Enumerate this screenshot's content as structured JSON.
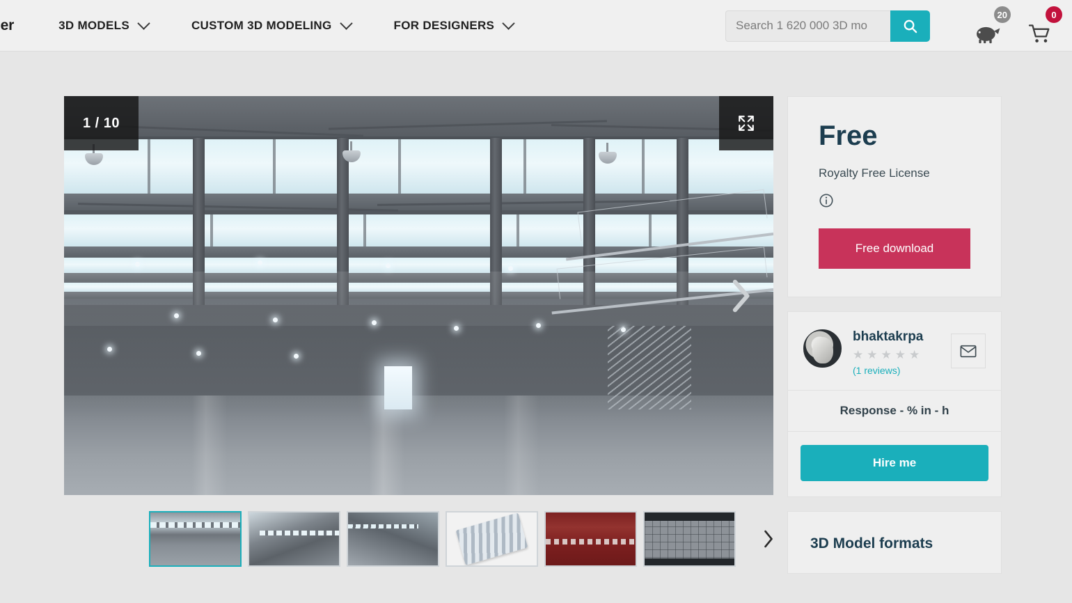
{
  "header": {
    "logo": "der",
    "nav": [
      {
        "label": "3D MODELS",
        "icon": "chevron-down-icon"
      },
      {
        "label": "CUSTOM 3D MODELING",
        "icon": "chevron-down-icon"
      },
      {
        "label": "FOR DESIGNERS",
        "icon": "chevron-down-icon"
      }
    ],
    "search": {
      "placeholder": "Search 1 620 000 3D mo",
      "value": "",
      "button_icon": "search-icon"
    },
    "piggy": {
      "icon": "piggy-bank-icon",
      "badge": "20"
    },
    "cart": {
      "icon": "shopping-cart-icon",
      "badge": "0"
    }
  },
  "gallery": {
    "counter": "1 / 10",
    "fullscreen_icon": "expand-icon",
    "next_icon": "chevron-right-icon",
    "main_image_alt": "Industrial warehouse interior with steel trusses, clerestory windows, pendant lights and polished concrete floor",
    "thumbnails": [
      {
        "alt": "Warehouse interior wide view",
        "active": true
      },
      {
        "alt": "Warehouse interior angled view",
        "active": false
      },
      {
        "alt": "Warehouse interior perspective down the hall",
        "active": false
      },
      {
        "alt": "Roof panel 3D render on white",
        "active": false
      },
      {
        "alt": "Warehouse clay render in red",
        "active": false
      },
      {
        "alt": "Wireframe viewport screenshot",
        "active": false
      }
    ],
    "thumbs_next_icon": "chevron-right-icon"
  },
  "sidebar": {
    "price": {
      "amount": "Free",
      "license": "Royalty Free License",
      "info_icon": "info-circle-icon",
      "download_label": "Free download"
    },
    "author": {
      "avatar_icon": "user-avatar",
      "name": "bhaktakrpa",
      "stars": [
        "★",
        "★",
        "★",
        "★",
        "★"
      ],
      "rating_filled": 0,
      "reviews": "(1 reviews)",
      "mail_icon": "envelope-icon",
      "response": "Response - % in - h",
      "hire_label": "Hire me"
    },
    "formats": {
      "title": "3D Model formats"
    }
  },
  "colors": {
    "brand_teal": "#1aafbb",
    "accent_red": "#c8335a",
    "badge_red": "#c2123c",
    "badge_gray": "#8c8c8c",
    "heading_navy": "#1c3d4f",
    "header_bg": "#f0f0f0",
    "page_bg": "#e6e6e6",
    "card_bg": "#efefef"
  }
}
